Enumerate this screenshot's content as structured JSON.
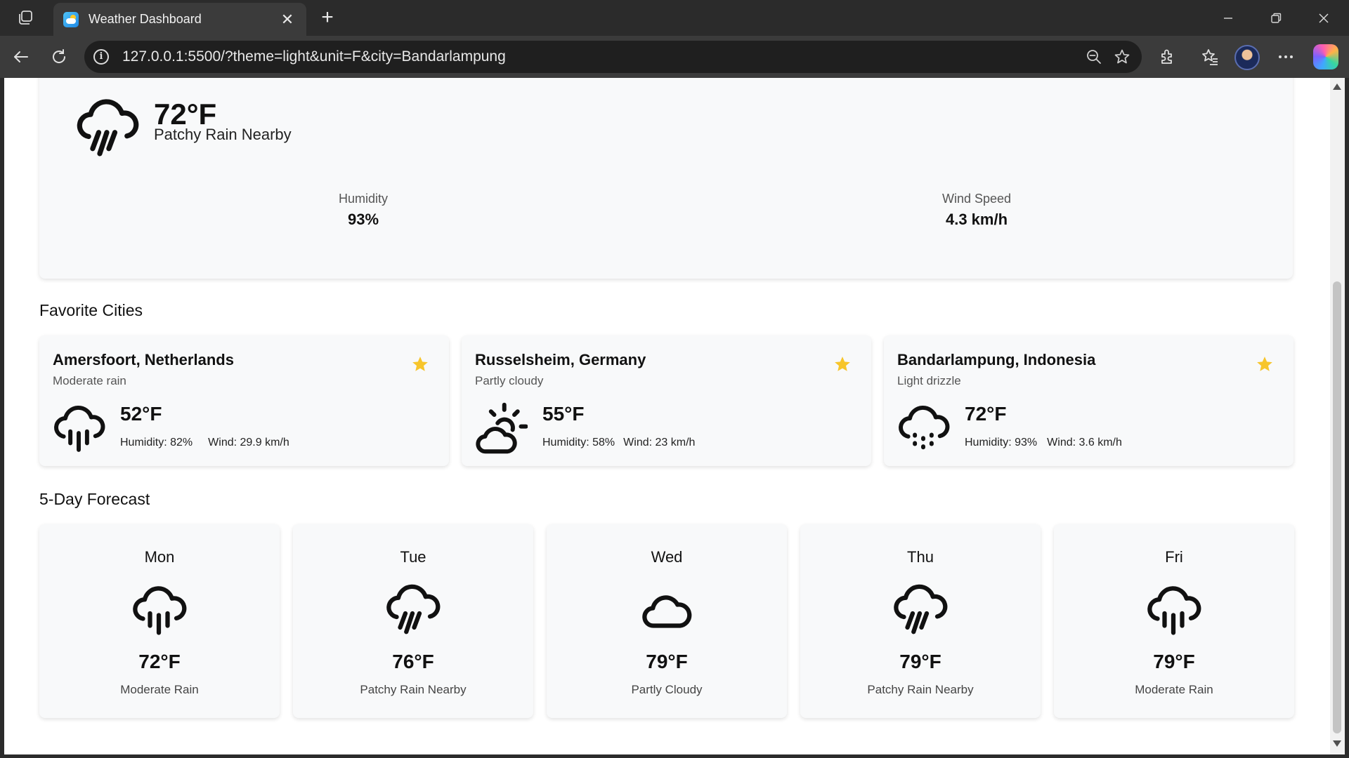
{
  "browser": {
    "tab_title": "Weather Dashboard",
    "url": "127.0.0.1:5500/?theme=light&unit=F&city=Bandarlampung"
  },
  "current": {
    "icon": "rain-heavy-icon",
    "temp": "72°F",
    "condition": "Patchy Rain Nearby",
    "humidity_label": "Humidity",
    "humidity_value": "93%",
    "wind_label": "Wind Speed",
    "wind_value": "4.3 km/h"
  },
  "favorites": {
    "title": "Favorite Cities",
    "star_color": "#f7c52b",
    "items": [
      {
        "name": "Amersfoort, Netherlands",
        "condition": "Moderate rain",
        "icon": "rain-icon",
        "temp": "52°F",
        "humidity": "Humidity: 82%",
        "wind": "Wind: 29.9 km/h"
      },
      {
        "name": "Russelsheim, Germany",
        "condition": "Partly cloudy",
        "icon": "partly-cloudy-icon",
        "temp": "55°F",
        "humidity": "Humidity: 58%",
        "wind": "Wind: 23 km/h"
      },
      {
        "name": "Bandarlampung, Indonesia",
        "condition": "Light drizzle",
        "icon": "drizzle-icon",
        "temp": "72°F",
        "humidity": "Humidity: 93%",
        "wind": "Wind: 3.6 km/h"
      }
    ]
  },
  "forecast": {
    "title": "5-Day Forecast",
    "days": [
      {
        "day": "Mon",
        "icon": "rain-icon",
        "temp": "72°F",
        "condition": "Moderate Rain"
      },
      {
        "day": "Tue",
        "icon": "rain-heavy-icon",
        "temp": "76°F",
        "condition": "Patchy Rain Nearby"
      },
      {
        "day": "Wed",
        "icon": "cloud-icon",
        "temp": "79°F",
        "condition": "Partly Cloudy"
      },
      {
        "day": "Thu",
        "icon": "rain-heavy-icon",
        "temp": "79°F",
        "condition": "Patchy Rain Nearby"
      },
      {
        "day": "Fri",
        "icon": "rain-icon",
        "temp": "79°F",
        "condition": "Moderate Rain"
      }
    ]
  }
}
